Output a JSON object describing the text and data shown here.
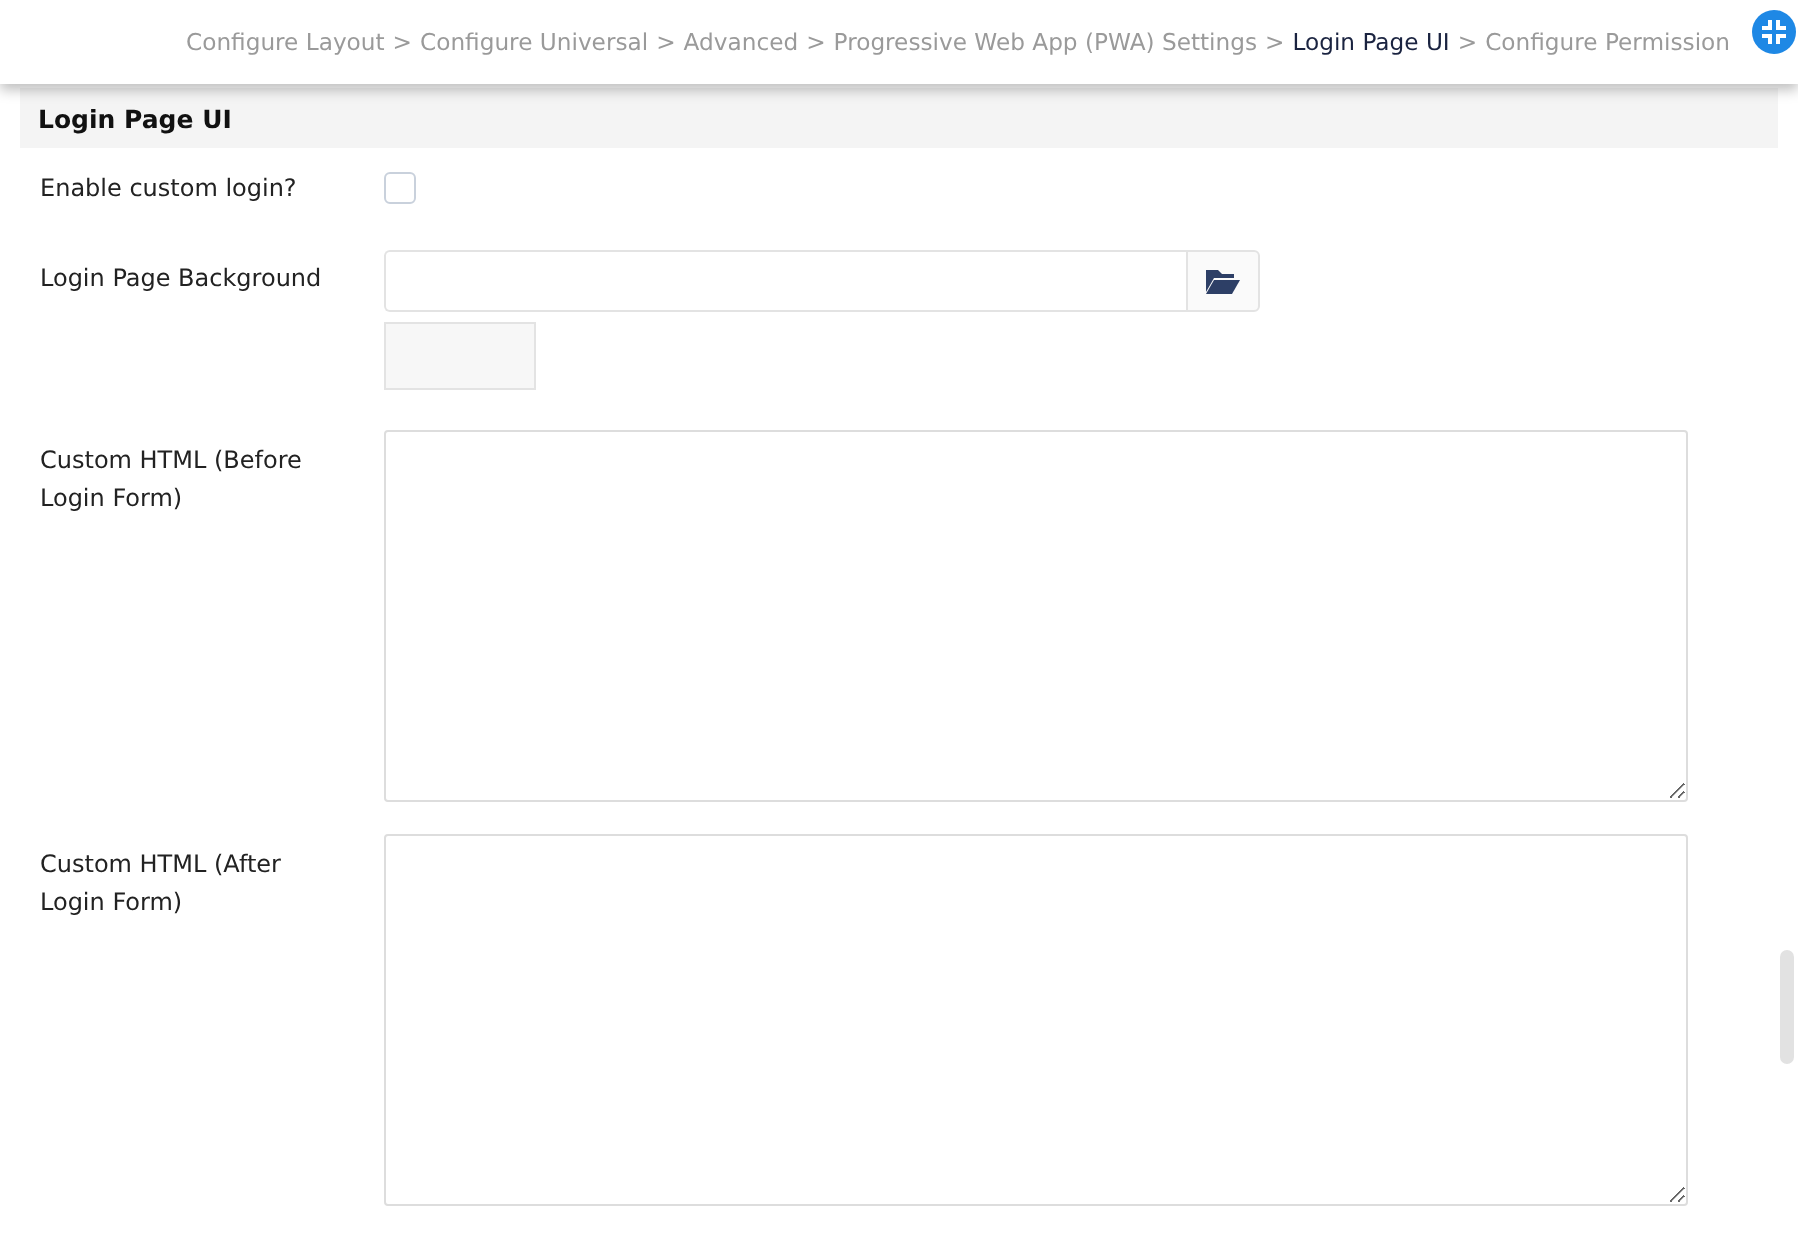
{
  "breadcrumb": {
    "separator": ">",
    "items": [
      {
        "label": "Configure Layout",
        "selected": false
      },
      {
        "label": "Configure Universal",
        "selected": false
      },
      {
        "label": "Advanced",
        "selected": false
      },
      {
        "label": "Progressive Web App (PWA) Settings",
        "selected": false
      },
      {
        "label": "Login Page UI",
        "selected": true
      },
      {
        "label": "Configure Permission",
        "selected": false
      }
    ]
  },
  "section": {
    "title": "Login Page UI"
  },
  "fields": [
    {
      "kind": "checkbox",
      "label": "Enable custom login?",
      "checked": false
    },
    {
      "kind": "file",
      "label": "Login Page Background"
    },
    {
      "kind": "textarea",
      "label": "Custom HTML (Before Login Form)"
    },
    {
      "kind": "textarea",
      "label": "Custom HTML (After Login Form)"
    }
  ]
}
